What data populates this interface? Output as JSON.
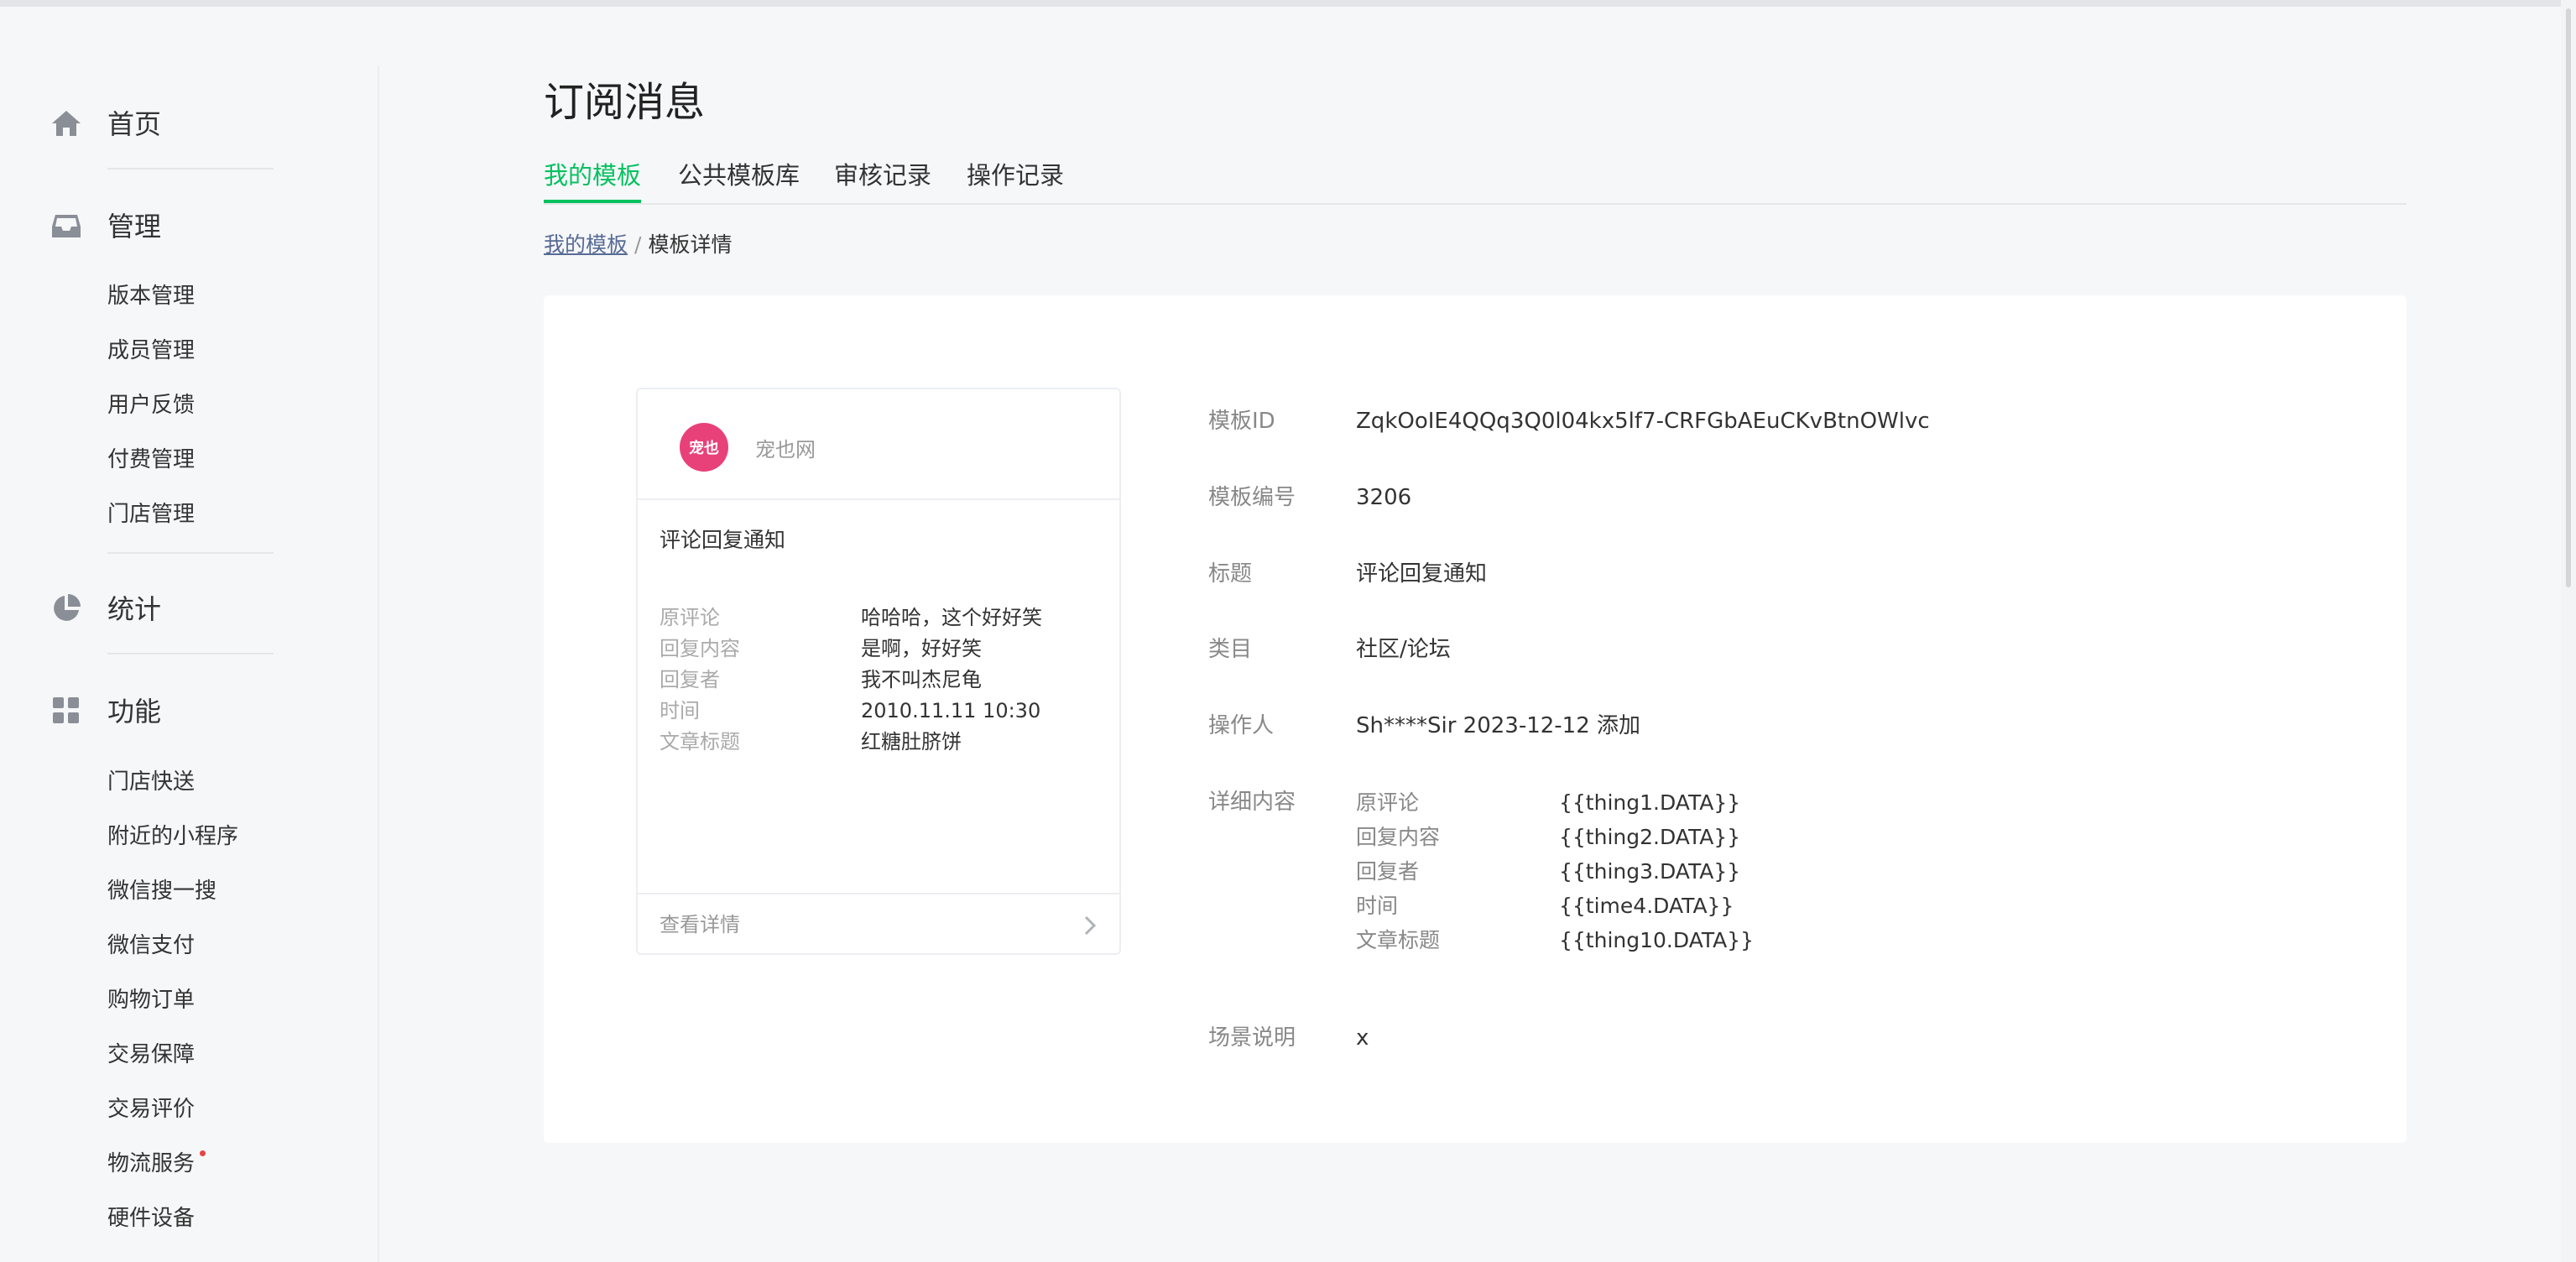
{
  "sidebar": {
    "home": {
      "label": "首页",
      "icon": "home-icon"
    },
    "manage": {
      "label": "管理",
      "icon": "inbox-icon",
      "items": [
        "版本管理",
        "成员管理",
        "用户反馈",
        "付费管理",
        "门店管理"
      ]
    },
    "stats": {
      "label": "统计",
      "icon": "pie-chart-icon"
    },
    "features": {
      "label": "功能",
      "icon": "grid-icon",
      "items": [
        "门店快送",
        "附近的小程序",
        "微信搜一搜",
        "微信支付",
        "购物订单",
        "交易保障",
        "交易评价",
        "物流服务",
        "硬件设备"
      ],
      "dot_item": "物流服务"
    }
  },
  "header": {
    "title": "订阅消息",
    "tabs": [
      {
        "label": "我的模板",
        "active": true
      },
      {
        "label": "公共模板库",
        "active": false
      },
      {
        "label": "审核记录",
        "active": false
      },
      {
        "label": "操作记录",
        "active": false
      }
    ]
  },
  "breadcrumb": {
    "link": "我的模板",
    "separator": "/",
    "current": "模板详情"
  },
  "preview": {
    "brand": "宠也网",
    "logo_text": "宠也",
    "title": "评论回复通知",
    "rows": [
      {
        "k": "原评论",
        "v": "哈哈哈，这个好好笑"
      },
      {
        "k": "回复内容",
        "v": "是啊，好好笑"
      },
      {
        "k": "回复者",
        "v": "我不叫杰尼龟"
      },
      {
        "k": "时间",
        "v": "2010.11.11 10:30"
      },
      {
        "k": "文章标题",
        "v": "红糖肚脐饼"
      }
    ],
    "footer": "查看详情"
  },
  "details": {
    "template_id": {
      "k": "模板ID",
      "v": "ZqkOoIE4QQq3Q0l04kx5lf7-CRFGbAEuCKvBtnOWlvc"
    },
    "template_no": {
      "k": "模板编号",
      "v": "3206"
    },
    "title": {
      "k": "标题",
      "v": "评论回复通知"
    },
    "category": {
      "k": "类目",
      "v": "社区/论坛"
    },
    "operator": {
      "k": "操作人",
      "v": "Sh****Sir 2023-12-12 添加"
    },
    "content": {
      "k": "详细内容",
      "rows": [
        {
          "k": "原评论",
          "v": "{{thing1.DATA}}"
        },
        {
          "k": "回复内容",
          "v": "{{thing2.DATA}}"
        },
        {
          "k": "回复者",
          "v": "{{thing3.DATA}}"
        },
        {
          "k": "时间",
          "v": "{{time4.DATA}}"
        },
        {
          "k": "文章标题",
          "v": "{{thing10.DATA}}"
        }
      ]
    },
    "scene": {
      "k": "场景说明",
      "v": "x"
    }
  },
  "colors": {
    "accent": "#07c160",
    "link": "#576b95",
    "logo": "#e8417a",
    "dot": "#e54545"
  }
}
